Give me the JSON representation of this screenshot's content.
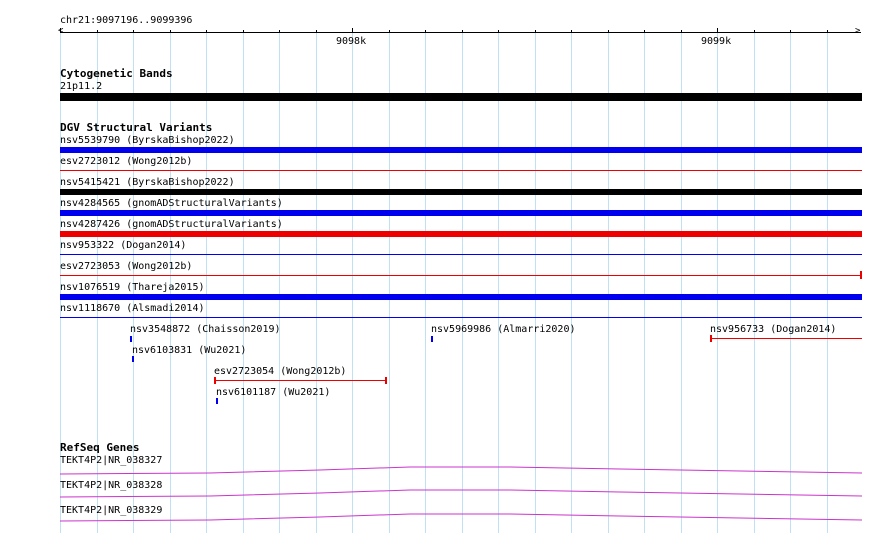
{
  "region": "chr21:9097196..9099396",
  "ruler": {
    "major_labels": [
      "9098k",
      "9099k"
    ]
  },
  "tracks": {
    "cytoband": {
      "title": "Cytogenetic Bands",
      "band_label": "21p11.2",
      "band_color": "#000000"
    },
    "dgv": {
      "title": "DGV Structural Variants",
      "full_rows": [
        {
          "label": "nsv5539790 (ByrskaBishop2022)",
          "color": "#0000ee",
          "style": "thick"
        },
        {
          "label": "esv2723012 (Wong2012b)",
          "color": "#ee0000",
          "style": "thin"
        },
        {
          "label": "nsv5415421 (ByrskaBishop2022)",
          "color": "#000000",
          "style": "thick"
        },
        {
          "label": "nsv4284565 (gnomADStructuralVariants)",
          "color": "#0000ee",
          "style": "thick"
        },
        {
          "label": "nsv4287426 (gnomADStructuralVariants)",
          "color": "#ee0000",
          "style": "thick"
        },
        {
          "label": "nsv953322 (Dogan2014)",
          "color": "#0000ee",
          "style": "thin"
        },
        {
          "label": "esv2723053 (Wong2012b)",
          "color": "#ee0000",
          "style": "thin-end"
        },
        {
          "label": "nsv1076519 (Thareja2015)",
          "color": "#0000ee",
          "style": "thick"
        },
        {
          "label": "nsv1118670 (Alsmadi2014)",
          "color": "#0000ee",
          "style": "thin"
        }
      ],
      "short_features": [
        {
          "label": "nsv3548872 (Chaisson2019)",
          "color": "#0000ee"
        },
        {
          "label": "nsv5969986 (Almarri2020)",
          "color": "#0000ee"
        },
        {
          "label": "nsv956733 (Dogan2014)",
          "color": "#ee0000"
        },
        {
          "label": "nsv6103831 (Wu2021)",
          "color": "#0000ee"
        },
        {
          "label": "esv2723054 (Wong2012b)",
          "color": "#ee0000"
        },
        {
          "label": "nsv6101187 (Wu2021)",
          "color": "#0000ee"
        }
      ]
    },
    "refseq": {
      "title": "RefSeq Genes",
      "genes": [
        {
          "label": "TEKT4P2|NR_038327"
        },
        {
          "label": "TEKT4P2|NR_038328"
        },
        {
          "label": "TEKT4P2|NR_038329"
        }
      ],
      "gene_color": "#cc33cc"
    }
  },
  "colors": {
    "grid": "#bfe1f3",
    "ruler": "#000000"
  }
}
